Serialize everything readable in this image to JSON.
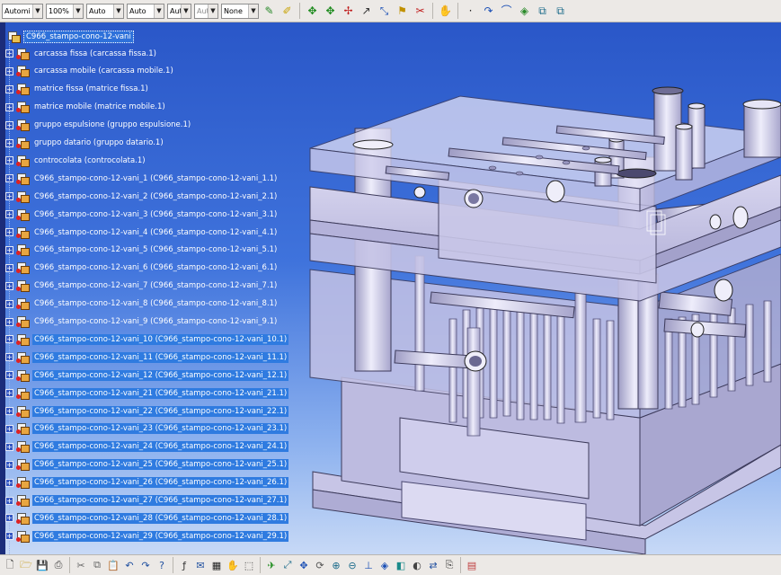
{
  "toolbar": {
    "combos": [
      {
        "name": "line-type-combo",
        "value": "Automi",
        "disabled": false
      },
      {
        "name": "zoom-combo",
        "value": "100%",
        "disabled": false
      },
      {
        "name": "thickness-combo",
        "value": "Auto",
        "disabled": false
      },
      {
        "name": "style-combo",
        "value": "Auto",
        "disabled": false
      },
      {
        "name": "layer-combo",
        "value": "Aut",
        "disabled": false
      },
      {
        "name": "point-combo",
        "value": "Aut",
        "disabled": true
      },
      {
        "name": "render-combo",
        "value": "None",
        "disabled": false
      }
    ]
  },
  "tree": {
    "root": "C966_stampo-cono-12-vani",
    "items": [
      {
        "label": "carcassa fissa (carcassa fissa.1)",
        "selected": false
      },
      {
        "label": "carcassa mobile (carcassa mobile.1)",
        "selected": false
      },
      {
        "label": "matrice fissa (matrice fissa.1)",
        "selected": false
      },
      {
        "label": "matrice mobile (matrice mobile.1)",
        "selected": false
      },
      {
        "label": "gruppo espulsione (gruppo espulsione.1)",
        "selected": false
      },
      {
        "label": "gruppo datario (gruppo datario.1)",
        "selected": false
      },
      {
        "label": "controcolata (controcolata.1)",
        "selected": false
      },
      {
        "label": "C966_stampo-cono-12-vani_1 (C966_stampo-cono-12-vani_1.1)",
        "selected": false
      },
      {
        "label": "C966_stampo-cono-12-vani_2 (C966_stampo-cono-12-vani_2.1)",
        "selected": false
      },
      {
        "label": "C966_stampo-cono-12-vani_3 (C966_stampo-cono-12-vani_3.1)",
        "selected": false
      },
      {
        "label": "C966_stampo-cono-12-vani_4 (C966_stampo-cono-12-vani_4.1)",
        "selected": false
      },
      {
        "label": "C966_stampo-cono-12-vani_5 (C966_stampo-cono-12-vani_5.1)",
        "selected": false
      },
      {
        "label": "C966_stampo-cono-12-vani_6 (C966_stampo-cono-12-vani_6.1)",
        "selected": false
      },
      {
        "label": "C966_stampo-cono-12-vani_7 (C966_stampo-cono-12-vani_7.1)",
        "selected": false
      },
      {
        "label": "C966_stampo-cono-12-vani_8 (C966_stampo-cono-12-vani_8.1)",
        "selected": false
      },
      {
        "label": "C966_stampo-cono-12-vani_9 (C966_stampo-cono-12-vani_9.1)",
        "selected": false
      },
      {
        "label": "C966_stampo-cono-12-vani_10 (C966_stampo-cono-12-vani_10.1)",
        "selected": true
      },
      {
        "label": "C966_stampo-cono-12-vani_11 (C966_stampo-cono-12-vani_11.1)",
        "selected": true
      },
      {
        "label": "C966_stampo-cono-12-vani_12 (C966_stampo-cono-12-vani_12.1)",
        "selected": true
      },
      {
        "label": "C966_stampo-cono-12-vani_21 (C966_stampo-cono-12-vani_21.1)",
        "selected": true
      },
      {
        "label": "C966_stampo-cono-12-vani_22 (C966_stampo-cono-12-vani_22.1)",
        "selected": true
      },
      {
        "label": "C966_stampo-cono-12-vani_23 (C966_stampo-cono-12-vani_23.1)",
        "selected": true
      },
      {
        "label": "C966_stampo-cono-12-vani_24 (C966_stampo-cono-12-vani_24.1)",
        "selected": true
      },
      {
        "label": "C966_stampo-cono-12-vani_25 (C966_stampo-cono-12-vani_25.1)",
        "selected": true
      },
      {
        "label": "C966_stampo-cono-12-vani_26 (C966_stampo-cono-12-vani_26.1)",
        "selected": true
      },
      {
        "label": "C966_stampo-cono-12-vani_27 (C966_stampo-cono-12-vani_27.1)",
        "selected": true
      },
      {
        "label": "C966_stampo-cono-12-vani_28 (C966_stampo-cono-12-vani_28.1)",
        "selected": true
      },
      {
        "label": "C966_stampo-cono-12-vani_29 (C966_stampo-cono-12-vani_29.1)",
        "selected": true
      }
    ]
  },
  "icons": {
    "top": [
      "paint-brush-icon",
      "eraser-icon",
      "pan-icon",
      "rotate-icon",
      "snap-icon",
      "sketch-icon",
      "dimension-icon",
      "annotation-icon",
      "hide-show-icon",
      "manipulate-icon",
      "point-icon",
      "line-icon",
      "curve-icon",
      "surface-icon",
      "measure-icon",
      "swap-icon"
    ],
    "bottom": [
      "new-file-icon",
      "open-folder-icon",
      "save-icon",
      "print-icon",
      "cut-icon",
      "copy-icon",
      "paste-icon",
      "undo-icon",
      "redo-icon",
      "whats-this-icon",
      "formula-icon",
      "comment-icon",
      "grid-icon",
      "hand-icon",
      "select-icon",
      "fly-icon",
      "fit-all-icon",
      "pan-view-icon",
      "rotate-view-icon",
      "zoom-in-icon",
      "zoom-out-icon",
      "normal-view-icon",
      "iso-view-icon",
      "shading-icon",
      "hide-icon",
      "swap-space-icon",
      "capture-icon",
      "table-icon"
    ]
  }
}
